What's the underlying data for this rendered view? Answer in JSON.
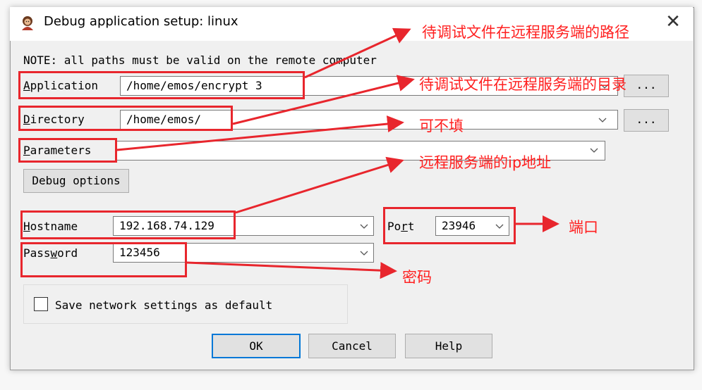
{
  "dialog": {
    "title": "Debug application setup: linux",
    "note": "NOTE: all paths must be valid on the remote computer"
  },
  "fields": {
    "application": {
      "label_mnemonic": "A",
      "label_rest": "pplication",
      "value": "/home/emos/encrypt 3"
    },
    "directory": {
      "label_mnemonic": "D",
      "label_rest": "irectory",
      "value": "/home/emos/"
    },
    "parameters": {
      "label_mnemonic": "P",
      "label_rest": "arameters",
      "value": ""
    },
    "hostname": {
      "label_mnemonic": "H",
      "label_rest": "ostname",
      "value": "192.168.74.129"
    },
    "port": {
      "label_pre": "Po",
      "label_mnemonic": "r",
      "label_post": "t",
      "value": "23946"
    },
    "password": {
      "label_pre": "Pass",
      "label_mnemonic": "w",
      "label_post": "ord",
      "value": "123456"
    }
  },
  "buttons": {
    "debug_options": "Debug options",
    "browse_app": "...",
    "browse_dir": "...",
    "ok": "OK",
    "cancel": "Cancel",
    "help": "Help"
  },
  "checkbox": {
    "label": "Save network settings as default",
    "checked": false
  },
  "annotations": {
    "application": "待调试文件在远程服务端的路径",
    "directory": "待调试文件在远程服务端的目录",
    "parameters": "可不填",
    "hostname": "远程服务端的ip地址",
    "port": "端口",
    "password": "密码"
  },
  "colors": {
    "annotation": "#e8262d",
    "default_button_border": "#0078d7"
  }
}
